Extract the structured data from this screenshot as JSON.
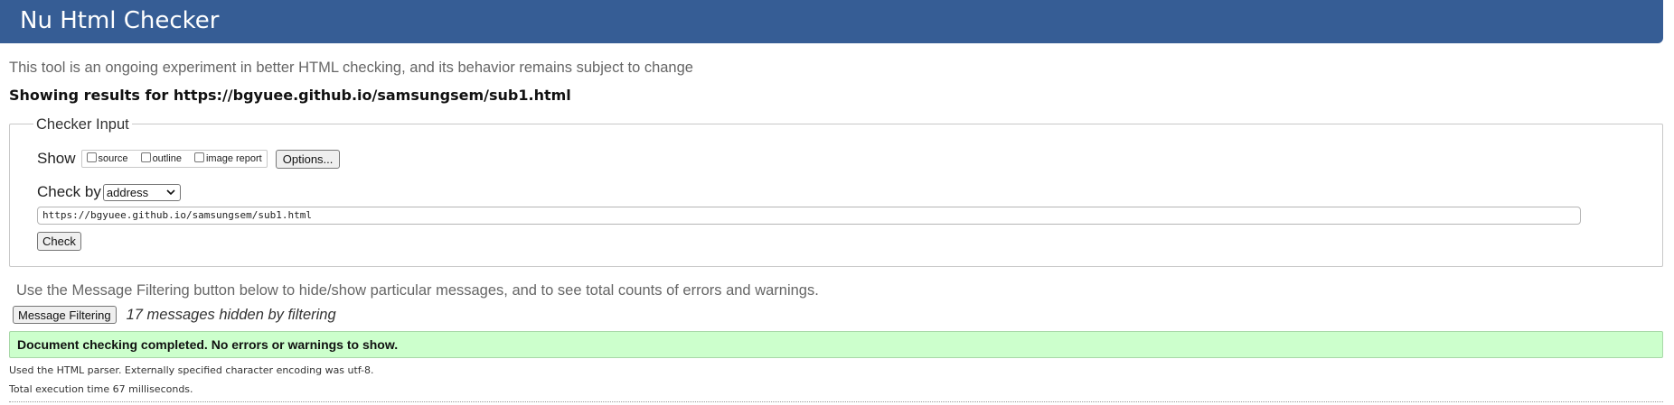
{
  "header": {
    "title": "Nu Html Checker",
    "bg_color": "#365d95"
  },
  "intro_text": "This tool is an ongoing experiment in better HTML checking, and its behavior remains subject to change",
  "showing_results": "Showing results for https://bgyuee.github.io/samsungsem/sub1.html",
  "checker_input": {
    "legend": "Checker Input",
    "show_label": "Show",
    "checkboxes": [
      {
        "label": "source",
        "checked": false
      },
      {
        "label": "outline",
        "checked": false
      },
      {
        "label": "image report",
        "checked": false
      }
    ],
    "options_button": "Options...",
    "check_by_label": "Check by",
    "check_by_value": "address",
    "url_value": "https://bgyuee.github.io/samsungsem/sub1.html",
    "check_button": "Check"
  },
  "filtering": {
    "note": "Use the Message Filtering button below to hide/show particular messages, and to see total counts of errors and warnings.",
    "button": "Message Filtering",
    "hidden_count_text": "17 messages hidden by filtering"
  },
  "result": {
    "success_message": "Document checking completed. No errors or warnings to show.",
    "success_bg": "#ccffcc",
    "parser_note": "Used the HTML parser. Externally specified character encoding was utf-8.",
    "execution_time": "Total execution time 67 milliseconds."
  }
}
